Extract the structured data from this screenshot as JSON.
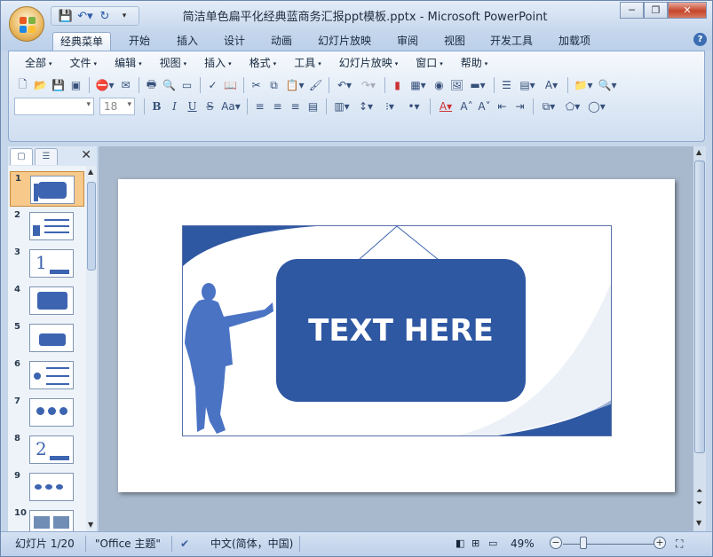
{
  "window": {
    "title": "简洁单色扁平化经典蓝商务汇报ppt模板.pptx - Microsoft PowerPoint",
    "minimize_icon": "minimize-icon",
    "restore_icon": "restore-icon",
    "close_icon": "close-icon"
  },
  "quick_access": [
    "save-icon",
    "undo-icon",
    "redo-icon",
    "customize-qat-icon"
  ],
  "ribbon_tabs": [
    {
      "label": "经典菜单",
      "active": true
    },
    {
      "label": "开始"
    },
    {
      "label": "插入"
    },
    {
      "label": "设计"
    },
    {
      "label": "动画"
    },
    {
      "label": "幻灯片放映"
    },
    {
      "label": "审阅"
    },
    {
      "label": "视图"
    },
    {
      "label": "开发工具"
    },
    {
      "label": "加载项"
    }
  ],
  "classic_menu": [
    "全部",
    "文件",
    "编辑",
    "视图",
    "插入",
    "格式",
    "工具",
    "幻灯片放映",
    "窗口",
    "帮助"
  ],
  "format_bar": {
    "font_name": "",
    "font_size": "18"
  },
  "thumbnails": {
    "selected": 1,
    "numbers": [
      "1",
      "2",
      "3",
      "4",
      "5",
      "6",
      "7",
      "8",
      "9",
      "10"
    ]
  },
  "slide": {
    "headline": "TEXT HERE",
    "accent_color": "#2f58a3",
    "figure_color": "#4a73c4"
  },
  "status": {
    "slide_counter": "幻灯片 1/20",
    "theme": "\"Office 主题\"",
    "language": "中文(简体，中国)",
    "zoom": "49%"
  }
}
